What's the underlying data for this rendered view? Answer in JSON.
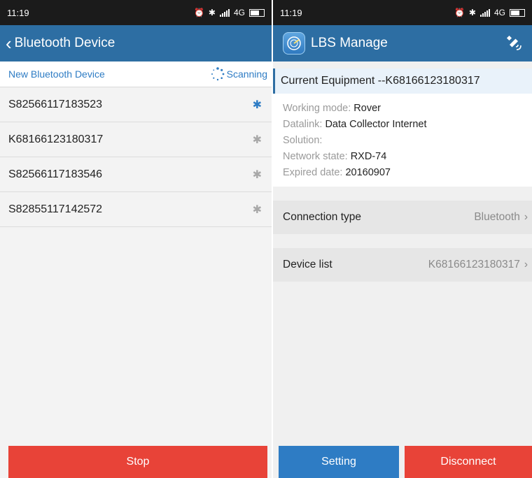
{
  "left": {
    "status_time": "11:19",
    "status_network": "4G",
    "title": "Bluetooth Device",
    "subheader_label": "New Bluetooth Device",
    "scanning_label": "Scanning",
    "devices": [
      {
        "id": "S82566117183523",
        "active": true
      },
      {
        "id": "K68166123180317",
        "active": false
      },
      {
        "id": "S82566117183546",
        "active": false
      },
      {
        "id": "S82855117142572",
        "active": false
      }
    ],
    "stop_label": "Stop"
  },
  "right": {
    "status_time": "11:19",
    "status_network": "4G",
    "title": "LBS Manage",
    "equipment_title": "Current Equipment --K68166123180317",
    "info": {
      "working_mode_label": "Working mode:",
      "working_mode_value": "Rover",
      "datalink_label": "Datalink:",
      "datalink_value": "Data Collector Internet",
      "solution_label": "Solution:",
      "solution_value": "",
      "network_state_label": "Network state:",
      "network_state_value": "RXD-74",
      "expired_label": "Expired date:",
      "expired_value": "20160907"
    },
    "connection_type_label": "Connection type",
    "connection_type_value": "Bluetooth",
    "device_list_label": "Device list",
    "device_list_value": "K68166123180317",
    "setting_label": "Setting",
    "disconnect_label": "Disconnect"
  },
  "colors": {
    "appbar": "#2d6ea3",
    "accent": "#2e7cc4",
    "danger": "#e84338"
  }
}
